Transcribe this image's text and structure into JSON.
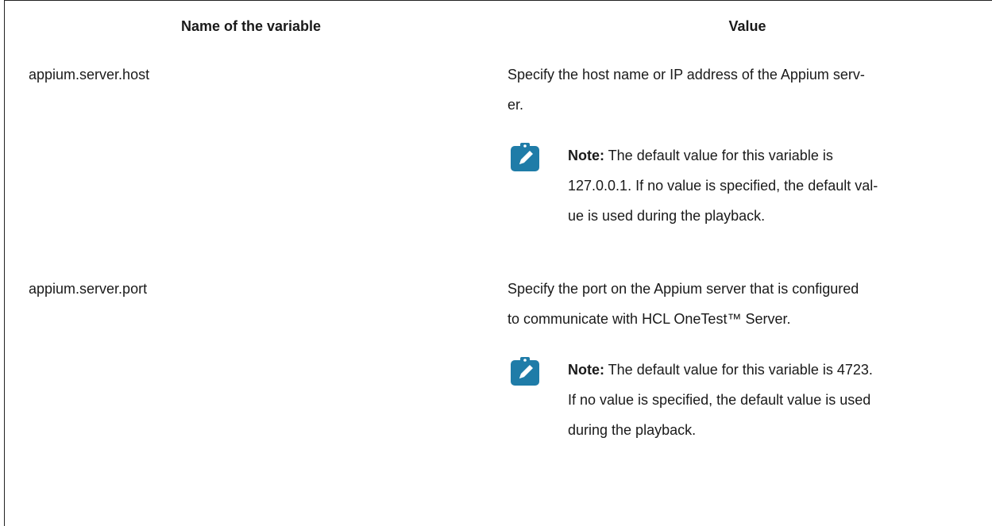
{
  "header": {
    "name_col": "Name of the variable",
    "value_col": "Value"
  },
  "rows": [
    {
      "name": "appium.server.host",
      "description_lines": [
        "Specify the host name or IP address of the Appium serv-",
        "er."
      ],
      "note": {
        "label": "Note:",
        "lines": [
          " The default value for this variable is",
          "127.0.0.1. If no value is specified, the default val-",
          "ue is used during the playback."
        ]
      }
    },
    {
      "name": "appium.server.port",
      "description_lines": [
        "Specify the port on the Appium server that is configured",
        "to communicate with HCL OneTest™ Server."
      ],
      "note": {
        "label": "Note:",
        "lines": [
          " The default value for this variable is 4723.",
          "If no value is specified, the default value is used",
          "during the playback."
        ]
      }
    }
  ],
  "colors": {
    "text": "#1a1a1a",
    "note_icon": "#1f7ca8",
    "border": "#222222"
  },
  "icons": {
    "note": "note-pencil-icon"
  }
}
